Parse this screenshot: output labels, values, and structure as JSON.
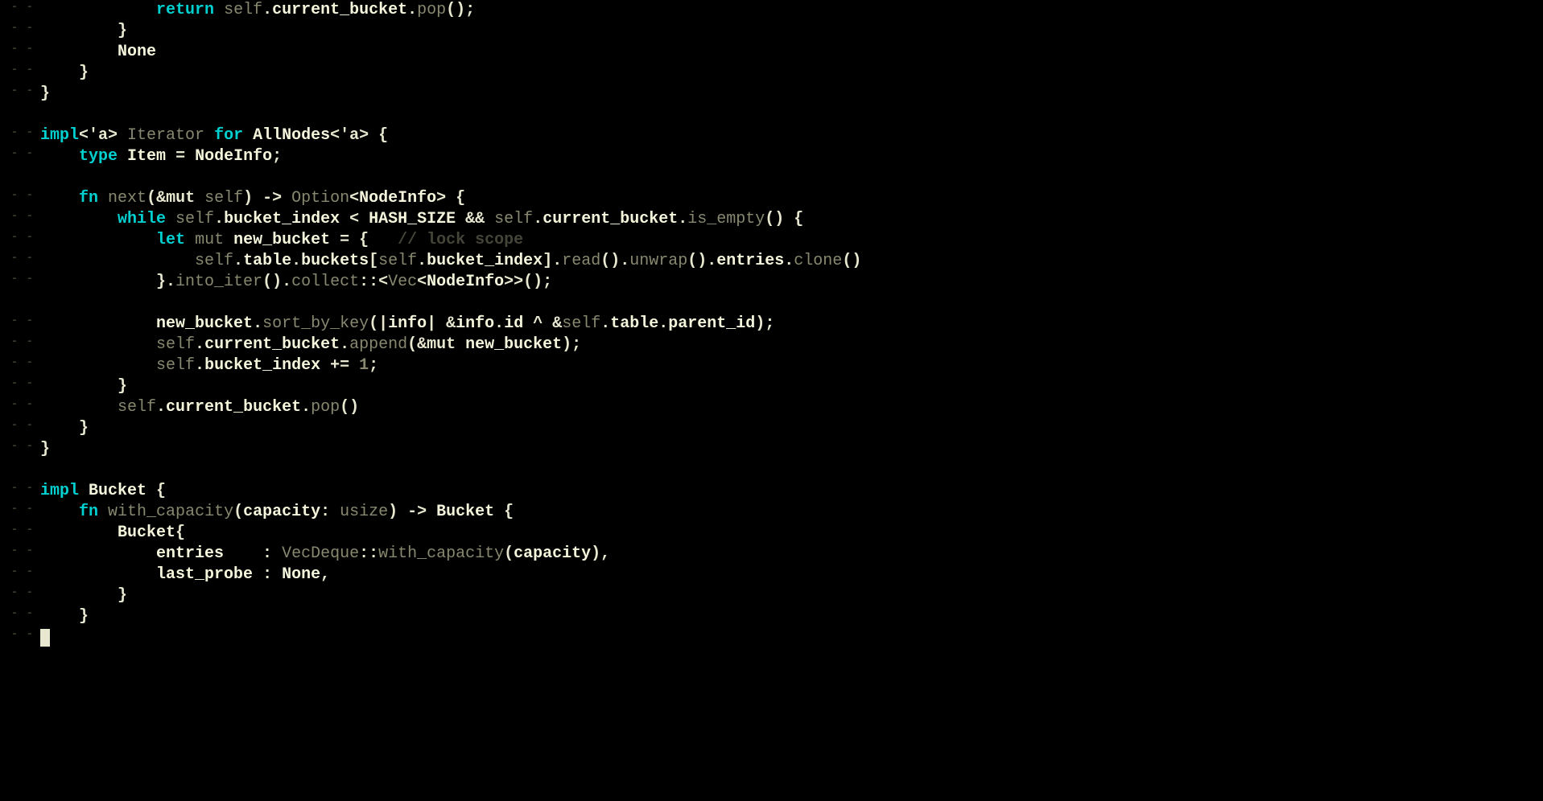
{
  "lines": [
    {
      "g": "- -",
      "tokens": [
        {
          "t": "            ",
          "c": ""
        },
        {
          "t": "return",
          "c": "kw"
        },
        {
          "t": " ",
          "c": ""
        },
        {
          "t": "self",
          "c": "dim"
        },
        {
          "t": ".",
          "c": "punct"
        },
        {
          "t": "current_bucket",
          "c": "ident"
        },
        {
          "t": ".",
          "c": "punct"
        },
        {
          "t": "pop",
          "c": "dim"
        },
        {
          "t": "();",
          "c": "punct"
        }
      ]
    },
    {
      "g": "- -",
      "tokens": [
        {
          "t": "        }",
          "c": "punct"
        }
      ]
    },
    {
      "g": "- -",
      "tokens": [
        {
          "t": "        ",
          "c": ""
        },
        {
          "t": "None",
          "c": "ident"
        }
      ]
    },
    {
      "g": "- -",
      "tokens": [
        {
          "t": "    }",
          "c": "punct"
        }
      ]
    },
    {
      "g": "- -",
      "tokens": [
        {
          "t": "}",
          "c": "punct"
        }
      ]
    },
    {
      "g": "",
      "tokens": [
        {
          "t": "",
          "c": ""
        }
      ]
    },
    {
      "g": "- -",
      "tokens": [
        {
          "t": "impl",
          "c": "kw"
        },
        {
          "t": "<'a> ",
          "c": "punct"
        },
        {
          "t": "Iterator",
          "c": "dim"
        },
        {
          "t": " ",
          "c": ""
        },
        {
          "t": "for",
          "c": "kw"
        },
        {
          "t": " ",
          "c": ""
        },
        {
          "t": "AllNodes",
          "c": "ident"
        },
        {
          "t": "<'a> {",
          "c": "punct"
        }
      ]
    },
    {
      "g": "- -",
      "tokens": [
        {
          "t": "    ",
          "c": ""
        },
        {
          "t": "type",
          "c": "kw"
        },
        {
          "t": " ",
          "c": ""
        },
        {
          "t": "Item",
          "c": "ident"
        },
        {
          "t": " = ",
          "c": "punct"
        },
        {
          "t": "NodeInfo",
          "c": "ident"
        },
        {
          "t": ";",
          "c": "punct"
        }
      ]
    },
    {
      "g": "",
      "tokens": [
        {
          "t": "",
          "c": ""
        }
      ]
    },
    {
      "g": "- -",
      "tokens": [
        {
          "t": "    ",
          "c": ""
        },
        {
          "t": "fn",
          "c": "kw"
        },
        {
          "t": " ",
          "c": ""
        },
        {
          "t": "next",
          "c": "dim"
        },
        {
          "t": "(&mut ",
          "c": "punct"
        },
        {
          "t": "self",
          "c": "dim"
        },
        {
          "t": ") -> ",
          "c": "punct"
        },
        {
          "t": "Option",
          "c": "dim"
        },
        {
          "t": "<",
          "c": "punct"
        },
        {
          "t": "NodeInfo",
          "c": "ident"
        },
        {
          "t": "> {",
          "c": "punct"
        }
      ]
    },
    {
      "g": "- -",
      "tokens": [
        {
          "t": "        ",
          "c": ""
        },
        {
          "t": "while",
          "c": "kw"
        },
        {
          "t": " ",
          "c": ""
        },
        {
          "t": "self",
          "c": "dim"
        },
        {
          "t": ".",
          "c": "punct"
        },
        {
          "t": "bucket_index",
          "c": "ident"
        },
        {
          "t": " < ",
          "c": "punct"
        },
        {
          "t": "HASH_SIZE",
          "c": "ident"
        },
        {
          "t": " && ",
          "c": "punct"
        },
        {
          "t": "self",
          "c": "dim"
        },
        {
          "t": ".",
          "c": "punct"
        },
        {
          "t": "current_bucket",
          "c": "ident"
        },
        {
          "t": ".",
          "c": "punct"
        },
        {
          "t": "is_empty",
          "c": "dim"
        },
        {
          "t": "() {",
          "c": "punct"
        }
      ]
    },
    {
      "g": "- -",
      "tokens": [
        {
          "t": "            ",
          "c": ""
        },
        {
          "t": "let",
          "c": "kw"
        },
        {
          "t": " ",
          "c": ""
        },
        {
          "t": "mut",
          "c": "dim"
        },
        {
          "t": " ",
          "c": ""
        },
        {
          "t": "new_bucket",
          "c": "ident"
        },
        {
          "t": " = {   ",
          "c": "punct"
        },
        {
          "t": "// lock scope",
          "c": "comment"
        }
      ]
    },
    {
      "g": "- -",
      "tokens": [
        {
          "t": "                ",
          "c": ""
        },
        {
          "t": "self",
          "c": "dim"
        },
        {
          "t": ".",
          "c": "punct"
        },
        {
          "t": "table",
          "c": "ident"
        },
        {
          "t": ".",
          "c": "punct"
        },
        {
          "t": "buckets",
          "c": "ident"
        },
        {
          "t": "[",
          "c": "punct"
        },
        {
          "t": "self",
          "c": "dim"
        },
        {
          "t": ".",
          "c": "punct"
        },
        {
          "t": "bucket_index",
          "c": "ident"
        },
        {
          "t": "].",
          "c": "punct"
        },
        {
          "t": "read",
          "c": "dim"
        },
        {
          "t": "().",
          "c": "punct"
        },
        {
          "t": "unwrap",
          "c": "dim"
        },
        {
          "t": "().",
          "c": "punct"
        },
        {
          "t": "entries",
          "c": "ident"
        },
        {
          "t": ".",
          "c": "punct"
        },
        {
          "t": "clone",
          "c": "dim"
        },
        {
          "t": "()",
          "c": "punct"
        }
      ]
    },
    {
      "g": "- -",
      "tokens": [
        {
          "t": "            }.",
          "c": "punct"
        },
        {
          "t": "into_iter",
          "c": "dim"
        },
        {
          "t": "().",
          "c": "punct"
        },
        {
          "t": "collect",
          "c": "dim"
        },
        {
          "t": "::<",
          "c": "punct"
        },
        {
          "t": "Vec",
          "c": "dim"
        },
        {
          "t": "<",
          "c": "punct"
        },
        {
          "t": "NodeInfo",
          "c": "ident"
        },
        {
          "t": ">>();",
          "c": "punct"
        }
      ]
    },
    {
      "g": "",
      "tokens": [
        {
          "t": "",
          "c": ""
        }
      ]
    },
    {
      "g": "- -",
      "tokens": [
        {
          "t": "            ",
          "c": ""
        },
        {
          "t": "new_bucket",
          "c": "ident"
        },
        {
          "t": ".",
          "c": "punct"
        },
        {
          "t": "sort_by_key",
          "c": "dim"
        },
        {
          "t": "(|",
          "c": "punct"
        },
        {
          "t": "info",
          "c": "ident"
        },
        {
          "t": "| &",
          "c": "punct"
        },
        {
          "t": "info",
          "c": "ident"
        },
        {
          "t": ".",
          "c": "punct"
        },
        {
          "t": "id",
          "c": "ident"
        },
        {
          "t": " ^ &",
          "c": "punct"
        },
        {
          "t": "self",
          "c": "dim"
        },
        {
          "t": ".",
          "c": "punct"
        },
        {
          "t": "table",
          "c": "ident"
        },
        {
          "t": ".",
          "c": "punct"
        },
        {
          "t": "parent_id",
          "c": "ident"
        },
        {
          "t": ");",
          "c": "punct"
        }
      ]
    },
    {
      "g": "- -",
      "tokens": [
        {
          "t": "            ",
          "c": ""
        },
        {
          "t": "self",
          "c": "dim"
        },
        {
          "t": ".",
          "c": "punct"
        },
        {
          "t": "current_bucket",
          "c": "ident"
        },
        {
          "t": ".",
          "c": "punct"
        },
        {
          "t": "append",
          "c": "dim"
        },
        {
          "t": "(&mut ",
          "c": "punct"
        },
        {
          "t": "new_bucket",
          "c": "ident"
        },
        {
          "t": ");",
          "c": "punct"
        }
      ]
    },
    {
      "g": "- -",
      "tokens": [
        {
          "t": "            ",
          "c": ""
        },
        {
          "t": "self",
          "c": "dim"
        },
        {
          "t": ".",
          "c": "punct"
        },
        {
          "t": "bucket_index",
          "c": "ident"
        },
        {
          "t": " += ",
          "c": "punct"
        },
        {
          "t": "1",
          "c": "num"
        },
        {
          "t": ";",
          "c": "punct"
        }
      ]
    },
    {
      "g": "- -",
      "tokens": [
        {
          "t": "        }",
          "c": "punct"
        }
      ]
    },
    {
      "g": "- -",
      "tokens": [
        {
          "t": "        ",
          "c": ""
        },
        {
          "t": "self",
          "c": "dim"
        },
        {
          "t": ".",
          "c": "punct"
        },
        {
          "t": "current_bucket",
          "c": "ident"
        },
        {
          "t": ".",
          "c": "punct"
        },
        {
          "t": "pop",
          "c": "dim"
        },
        {
          "t": "()",
          "c": "punct"
        }
      ]
    },
    {
      "g": "- -",
      "tokens": [
        {
          "t": "    }",
          "c": "punct"
        }
      ]
    },
    {
      "g": "- -",
      "tokens": [
        {
          "t": "}",
          "c": "punct"
        }
      ]
    },
    {
      "g": "",
      "tokens": [
        {
          "t": "",
          "c": ""
        }
      ]
    },
    {
      "g": "- -",
      "tokens": [
        {
          "t": "impl",
          "c": "kw"
        },
        {
          "t": " ",
          "c": ""
        },
        {
          "t": "Bucket",
          "c": "ident"
        },
        {
          "t": " {",
          "c": "punct"
        }
      ]
    },
    {
      "g": "- -",
      "tokens": [
        {
          "t": "    ",
          "c": ""
        },
        {
          "t": "fn",
          "c": "kw"
        },
        {
          "t": " ",
          "c": ""
        },
        {
          "t": "with_capacity",
          "c": "dim"
        },
        {
          "t": "(",
          "c": "punct"
        },
        {
          "t": "capacity",
          "c": "ident"
        },
        {
          "t": ": ",
          "c": "punct"
        },
        {
          "t": "usize",
          "c": "dim"
        },
        {
          "t": ") -> ",
          "c": "punct"
        },
        {
          "t": "Bucket",
          "c": "ident"
        },
        {
          "t": " {",
          "c": "punct"
        }
      ]
    },
    {
      "g": "- -",
      "tokens": [
        {
          "t": "        ",
          "c": ""
        },
        {
          "t": "Bucket",
          "c": "ident"
        },
        {
          "t": "{",
          "c": "punct"
        }
      ]
    },
    {
      "g": "- -",
      "tokens": [
        {
          "t": "            ",
          "c": ""
        },
        {
          "t": "entries",
          "c": "ident"
        },
        {
          "t": "    : ",
          "c": "punct"
        },
        {
          "t": "VecDeque",
          "c": "dim"
        },
        {
          "t": "::",
          "c": "punct"
        },
        {
          "t": "with_capacity",
          "c": "dim"
        },
        {
          "t": "(",
          "c": "punct"
        },
        {
          "t": "capacity",
          "c": "ident"
        },
        {
          "t": "),",
          "c": "punct"
        }
      ]
    },
    {
      "g": "- -",
      "tokens": [
        {
          "t": "            ",
          "c": ""
        },
        {
          "t": "last_probe",
          "c": "ident"
        },
        {
          "t": " : ",
          "c": "punct"
        },
        {
          "t": "None",
          "c": "ident"
        },
        {
          "t": ",",
          "c": "punct"
        }
      ]
    },
    {
      "g": "- -",
      "tokens": [
        {
          "t": "        }",
          "c": "punct"
        }
      ]
    },
    {
      "g": "- -",
      "tokens": [
        {
          "t": "    }",
          "c": "punct"
        }
      ]
    },
    {
      "g": "- -",
      "tokens": [
        {
          "t": "",
          "c": ""
        }
      ]
    }
  ]
}
